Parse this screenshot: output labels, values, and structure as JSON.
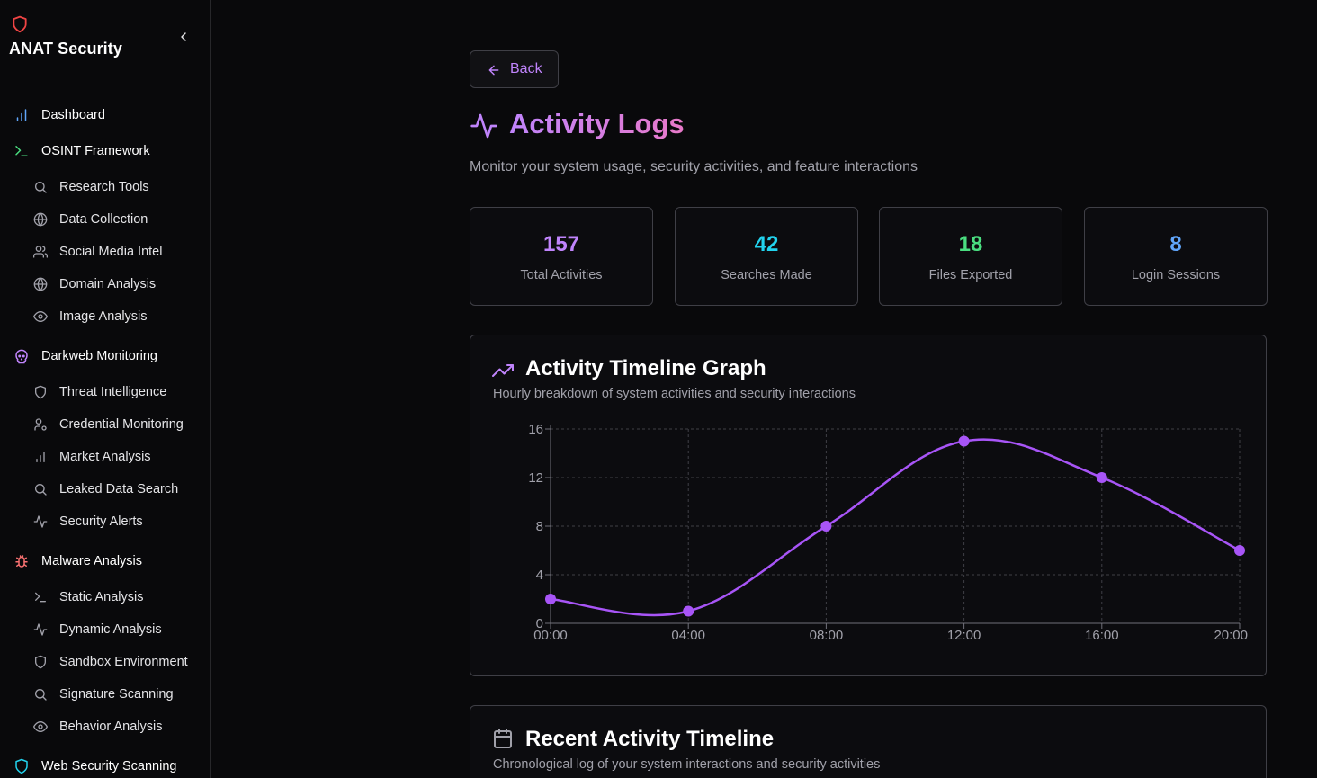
{
  "brand": {
    "title": "ANAT Security"
  },
  "sidebar": {
    "items": [
      {
        "kind": "group",
        "label": "Dashboard",
        "icon": "bar-chart-icon",
        "color": "#60a5fa"
      },
      {
        "kind": "group",
        "label": "OSINT Framework",
        "icon": "terminal-icon",
        "color": "#4ade80"
      },
      {
        "kind": "sub",
        "label": "Research Tools",
        "icon": "search-icon"
      },
      {
        "kind": "sub",
        "label": "Data Collection",
        "icon": "globe-icon"
      },
      {
        "kind": "sub",
        "label": "Social Media Intel",
        "icon": "users-icon"
      },
      {
        "kind": "sub",
        "label": "Domain Analysis",
        "icon": "globe-icon"
      },
      {
        "kind": "sub",
        "label": "Image Analysis",
        "icon": "eye-icon"
      },
      {
        "kind": "group",
        "label": "Darkweb Monitoring",
        "icon": "skull-icon",
        "color": "#c084fc"
      },
      {
        "kind": "sub",
        "label": "Threat Intelligence",
        "icon": "shield-icon"
      },
      {
        "kind": "sub",
        "label": "Credential Monitoring",
        "icon": "user-cog-icon"
      },
      {
        "kind": "sub",
        "label": "Market Analysis",
        "icon": "bar-chart-icon"
      },
      {
        "kind": "sub",
        "label": "Leaked Data Search",
        "icon": "search-icon"
      },
      {
        "kind": "sub",
        "label": "Security Alerts",
        "icon": "activity-icon"
      },
      {
        "kind": "group",
        "label": "Malware Analysis",
        "icon": "bug-icon",
        "color": "#f87171"
      },
      {
        "kind": "sub",
        "label": "Static Analysis",
        "icon": "terminal-icon"
      },
      {
        "kind": "sub",
        "label": "Dynamic Analysis",
        "icon": "activity-icon"
      },
      {
        "kind": "sub",
        "label": "Sandbox Environment",
        "icon": "shield-icon"
      },
      {
        "kind": "sub",
        "label": "Signature Scanning",
        "icon": "search-icon"
      },
      {
        "kind": "sub",
        "label": "Behavior Analysis",
        "icon": "eye-icon"
      },
      {
        "kind": "group",
        "label": "Web Security Scanning",
        "icon": "shield-icon",
        "color": "#22d3ee"
      }
    ]
  },
  "header": {
    "back_label": "Back",
    "title": "Activity Logs",
    "subtitle": "Monitor your system usage, security activities, and feature interactions"
  },
  "stats": [
    {
      "value": "157",
      "label": "Total Activities",
      "color": "#c084fc"
    },
    {
      "value": "42",
      "label": "Searches Made",
      "color": "#22d3ee"
    },
    {
      "value": "18",
      "label": "Files Exported",
      "color": "#4ade80"
    },
    {
      "value": "8",
      "label": "Login Sessions",
      "color": "#60a5fa"
    }
  ],
  "timeline_graph": {
    "title": "Activity Timeline Graph",
    "subtitle": "Hourly breakdown of system activities and security interactions"
  },
  "recent": {
    "title": "Recent Activity Timeline",
    "subtitle": "Chronological log of your system interactions and security activities"
  },
  "chart_data": {
    "type": "line",
    "x": [
      "00:00",
      "04:00",
      "08:00",
      "12:00",
      "16:00",
      "20:00"
    ],
    "values": [
      2,
      1,
      8,
      15,
      12,
      6
    ],
    "yticks": [
      0,
      4,
      8,
      12,
      16
    ],
    "ylim": [
      0,
      16
    ],
    "grid": true,
    "color": "#a855f7"
  }
}
